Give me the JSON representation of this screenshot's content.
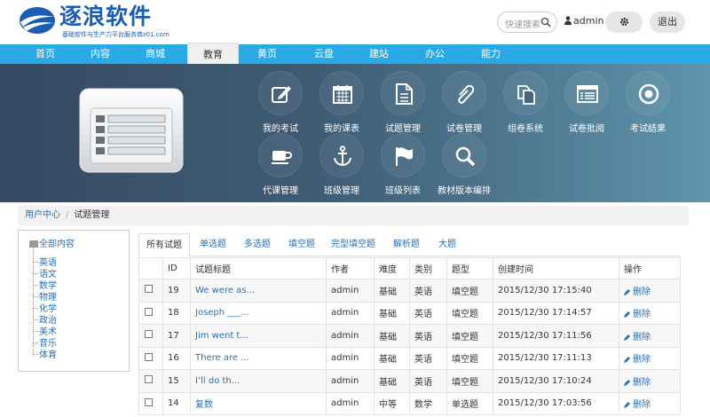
{
  "brand": {
    "title": "逐浪软件",
    "subtitle": "基础软件与生产力平台服务商z01.com",
    "color": "#1b5db3"
  },
  "header": {
    "search_placeholder": "快速搜索",
    "username": "admin",
    "logout_label": "退出"
  },
  "nav": [
    {
      "label": "首页"
    },
    {
      "label": "内容"
    },
    {
      "label": "商城"
    },
    {
      "label": "教育",
      "active": true
    },
    {
      "label": "黄页"
    },
    {
      "label": "云盘"
    },
    {
      "label": "建站"
    },
    {
      "label": "办公"
    },
    {
      "label": "能力"
    }
  ],
  "banner_tiles": [
    {
      "label": "我的考试",
      "icon": "edit-icon"
    },
    {
      "label": "我的课表",
      "icon": "calendar-icon"
    },
    {
      "label": "试题管理",
      "icon": "document-icon"
    },
    {
      "label": "试卷管理",
      "icon": "paperclip-icon"
    },
    {
      "label": "组卷系统",
      "icon": "copy-icon"
    },
    {
      "label": "试卷批阅",
      "icon": "list-window-icon"
    },
    {
      "label": "考试结果",
      "icon": "target-icon"
    },
    {
      "label": "代课管理",
      "icon": "coffee-cup-icon"
    },
    {
      "label": "班级管理",
      "icon": "anchor-icon"
    },
    {
      "label": "班级列表",
      "icon": "flag-icon"
    },
    {
      "label": "教材版本编排",
      "icon": "search-icon"
    }
  ],
  "breadcrumb": {
    "home": "用户中心",
    "current": "试题管理"
  },
  "tree": {
    "root": "全部内容",
    "items": [
      "英语",
      "语文",
      "数学",
      "物理",
      "化学",
      "政治",
      "美术",
      "音乐",
      "体育"
    ]
  },
  "tabs": [
    "所有试题",
    "单选题",
    "多选题",
    "填空题",
    "完型填空题",
    "解析题",
    "大题"
  ],
  "table": {
    "columns": [
      "ID",
      "试题标题",
      "作者",
      "难度",
      "类别",
      "题型",
      "创建时间",
      "操作"
    ],
    "action_label": "删除",
    "rows": [
      {
        "id": "19",
        "title": "We were as...",
        "author": "admin",
        "difficulty": "基础",
        "category": "英语",
        "type": "填空题",
        "created": "2015/12/30 17:15:40"
      },
      {
        "id": "18",
        "title": "Joseph ___...",
        "author": "admin",
        "difficulty": "基础",
        "category": "英语",
        "type": "填空题",
        "created": "2015/12/30 17:14:57"
      },
      {
        "id": "17",
        "title": "Jim went t...",
        "author": "admin",
        "difficulty": "基础",
        "category": "英语",
        "type": "填空题",
        "created": "2015/12/30 17:11:56"
      },
      {
        "id": "16",
        "title": "There are ...",
        "author": "admin",
        "difficulty": "基础",
        "category": "英语",
        "type": "填空题",
        "created": "2015/12/30 17:11:13"
      },
      {
        "id": "15",
        "title": "I’ll do th...",
        "author": "admin",
        "difficulty": "基础",
        "category": "英语",
        "type": "填空题",
        "created": "2015/12/30 17:10:24"
      },
      {
        "id": "14",
        "title": "复数",
        "author": "admin",
        "difficulty": "中等",
        "category": "数学",
        "type": "单选题",
        "created": "2015/12/30 17:03:56"
      }
    ]
  },
  "colors": {
    "nav": "#29a9e6",
    "link": "#2a6fb0",
    "banner_dark": "#364a62",
    "banner_light": "#5e95ab"
  }
}
